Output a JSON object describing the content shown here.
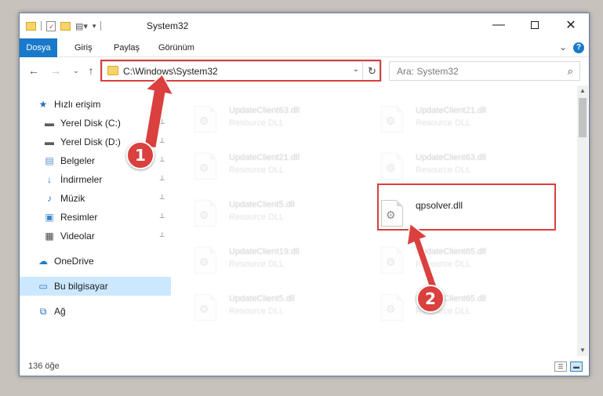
{
  "window": {
    "title": "System32"
  },
  "ribbon": {
    "tabs": [
      "Dosya",
      "Giriş",
      "Paylaş",
      "Görünüm"
    ]
  },
  "navigation": {
    "path": "C:\\Windows\\System32",
    "search_placeholder": "Ara: System32"
  },
  "sidebar": {
    "items": [
      {
        "label": "Hızlı erişim",
        "icon": "star-icon"
      },
      {
        "label": "Yerel Disk (C:)",
        "icon": "drive-icon",
        "pinned": true
      },
      {
        "label": "Yerel Disk (D:)",
        "icon": "drive-icon",
        "pinned": true
      },
      {
        "label": "Belgeler",
        "icon": "documents-icon",
        "pinned": true
      },
      {
        "label": "İndirmeler",
        "icon": "downloads-icon",
        "pinned": true
      },
      {
        "label": "Müzik",
        "icon": "music-icon",
        "pinned": true
      },
      {
        "label": "Resimler",
        "icon": "pictures-icon",
        "pinned": true
      },
      {
        "label": "Videolar",
        "icon": "videos-icon",
        "pinned": true
      },
      {
        "label": "OneDrive",
        "icon": "cloud-icon"
      },
      {
        "label": "Bu bilgisayar",
        "icon": "computer-icon",
        "selected": true
      },
      {
        "label": "Ağ",
        "icon": "network-icon"
      }
    ]
  },
  "files": [
    {
      "name": "UpdateClient63.dll",
      "type": "Resource DLL"
    },
    {
      "name": "UpdateClient21.dll",
      "type": "Resource DLL"
    },
    {
      "name": "UpdateClient21.dll",
      "type": "Resource DLL"
    },
    {
      "name": "UpdateClient63.dll",
      "type": "Resource DLL"
    },
    {
      "name": "UpdateClient5.dll",
      "type": "Resource DLL"
    },
    {
      "name": "qpsolver.dll",
      "type": ""
    },
    {
      "name": "UpdateClient19.dll",
      "type": "Resource DLL"
    },
    {
      "name": "UpdateClient65.dll",
      "type": "Resource DLL"
    },
    {
      "name": "UpdateClient5.dll",
      "type": "Resource DLL"
    },
    {
      "name": "UpdateClient65.dll",
      "type": "Resource DLL"
    }
  ],
  "status": {
    "item_count": "136 öğe"
  },
  "annotations": {
    "step1": "1",
    "step2": "2",
    "color": "#d9403e"
  },
  "colors": {
    "accent": "#1979ca",
    "selection": "#cce8ff"
  }
}
